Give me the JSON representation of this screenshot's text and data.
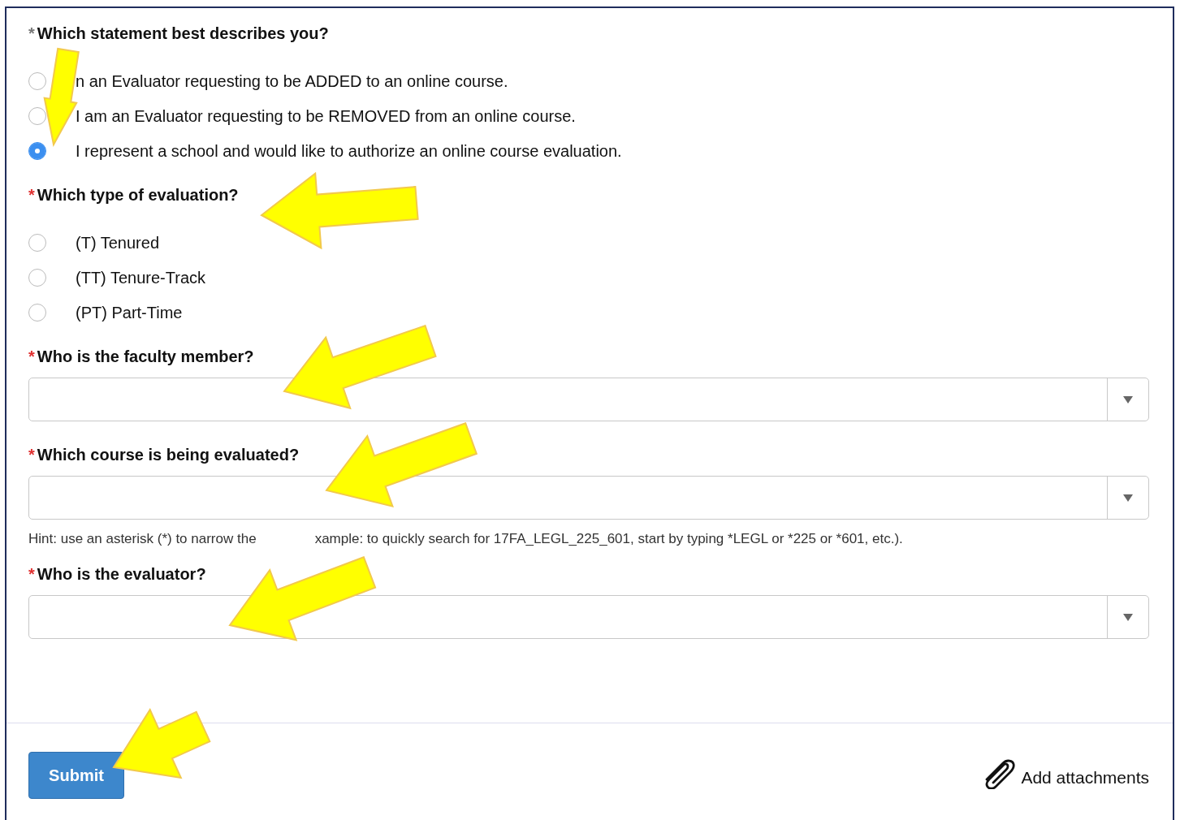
{
  "questions": [
    {
      "kind": "radio",
      "mark": "*",
      "label": "Which statement best describes you?",
      "required": false,
      "options": [
        {
          "label": "n an Evaluator requesting to be ADDED to an online course.",
          "selected": false
        },
        {
          "label": "I am an Evaluator requesting to be REMOVED from an online course.",
          "selected": false
        },
        {
          "label": "I represent a school and would like to authorize an online course evaluation.",
          "selected": true
        }
      ]
    },
    {
      "kind": "radio",
      "mark": "*",
      "label": "Which type of evaluation?",
      "required": true,
      "options": [
        {
          "label": "(T) Tenured",
          "selected": false
        },
        {
          "label": "(TT) Tenure-Track",
          "selected": false
        },
        {
          "label": "(PT) Part-Time",
          "selected": false
        }
      ]
    },
    {
      "kind": "select",
      "mark": "*",
      "label": "Who is the faculty member?",
      "required": true
    },
    {
      "kind": "select",
      "mark": "*",
      "label": "Which course is being evaluated?",
      "required": true,
      "hint": [
        "Hint: use an asterisk (*) to narrow the",
        "xample: to quickly search for 17FA_LEGL_225_601, start by typing *LEGL or *225 or *601, etc.)."
      ]
    },
    {
      "kind": "select",
      "mark": "*",
      "label": "Who is the evaluator?",
      "required": true
    }
  ],
  "submit": "Submit",
  "attachments": "Add attachments"
}
